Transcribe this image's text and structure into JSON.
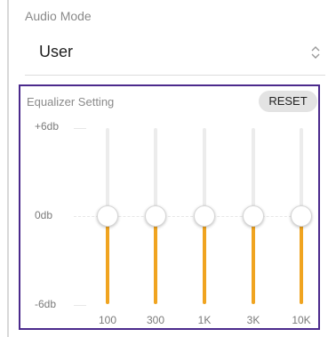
{
  "audio_mode": {
    "label": "Audio Mode",
    "selected": "User",
    "icon": "chevron-up-down-icon"
  },
  "equalizer": {
    "title": "Equalizer Setting",
    "reset_label": "RESET",
    "scale": {
      "max_label": "+6db",
      "mid_label": "0db",
      "min_label": "-6db",
      "max": 6,
      "min": -6
    },
    "fill_color": "#f0a420",
    "border_color": "#4b2a8c",
    "bands": [
      {
        "label": "100",
        "value": 0
      },
      {
        "label": "300",
        "value": 0
      },
      {
        "label": "1K",
        "value": 0
      },
      {
        "label": "3K",
        "value": 0
      },
      {
        "label": "10K",
        "value": 0
      }
    ]
  }
}
